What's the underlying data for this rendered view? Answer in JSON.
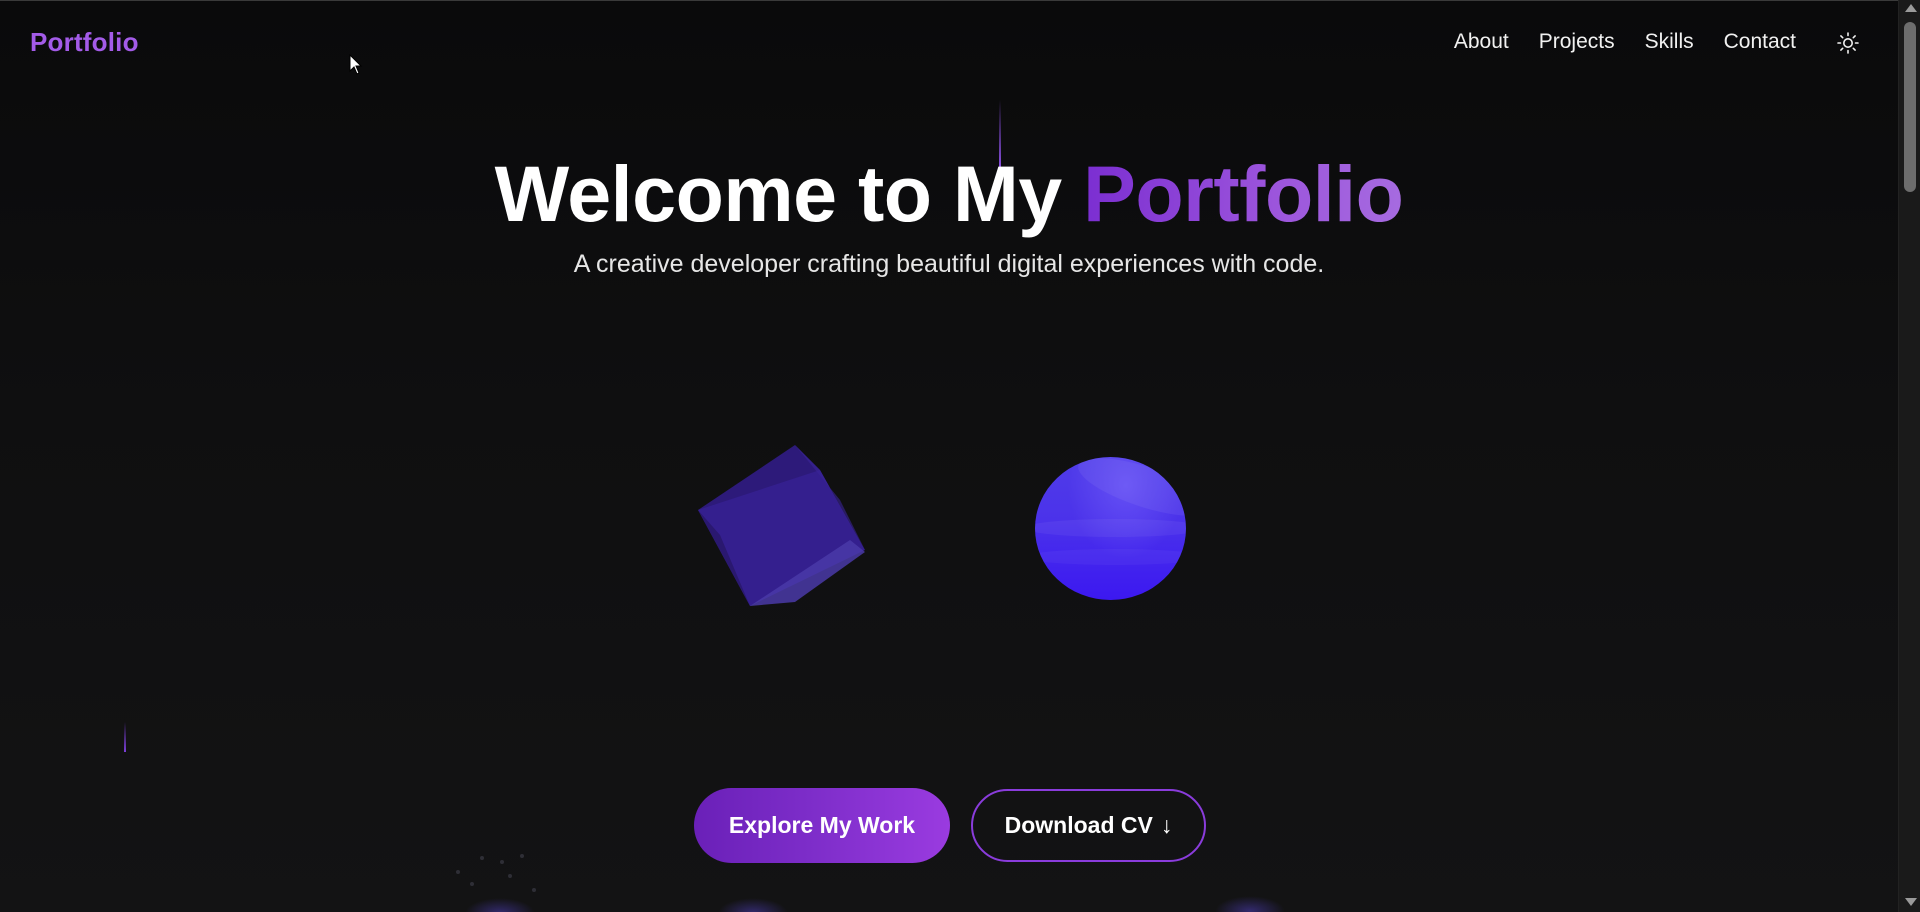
{
  "navbar": {
    "logo": "Portfolio",
    "links": [
      "About",
      "Projects",
      "Skills",
      "Contact"
    ],
    "theme_toggle_icon": "sun-icon"
  },
  "hero": {
    "title_main": "Welcome to My ",
    "title_accent": "Portfolio",
    "subtitle": "A creative developer crafting beautiful digital experiences with code."
  },
  "shapes": {
    "cube": "cube-shape",
    "sphere": "sphere-shape"
  },
  "buttons": {
    "primary_label": "Explore My Work",
    "secondary_label": "Download CV",
    "secondary_icon": "↓"
  },
  "colors": {
    "background": "#0b0b0c",
    "accent": "#8c50e6",
    "logo": "#a35be8",
    "sphere": "#4b32ea",
    "cube": "#352090"
  }
}
